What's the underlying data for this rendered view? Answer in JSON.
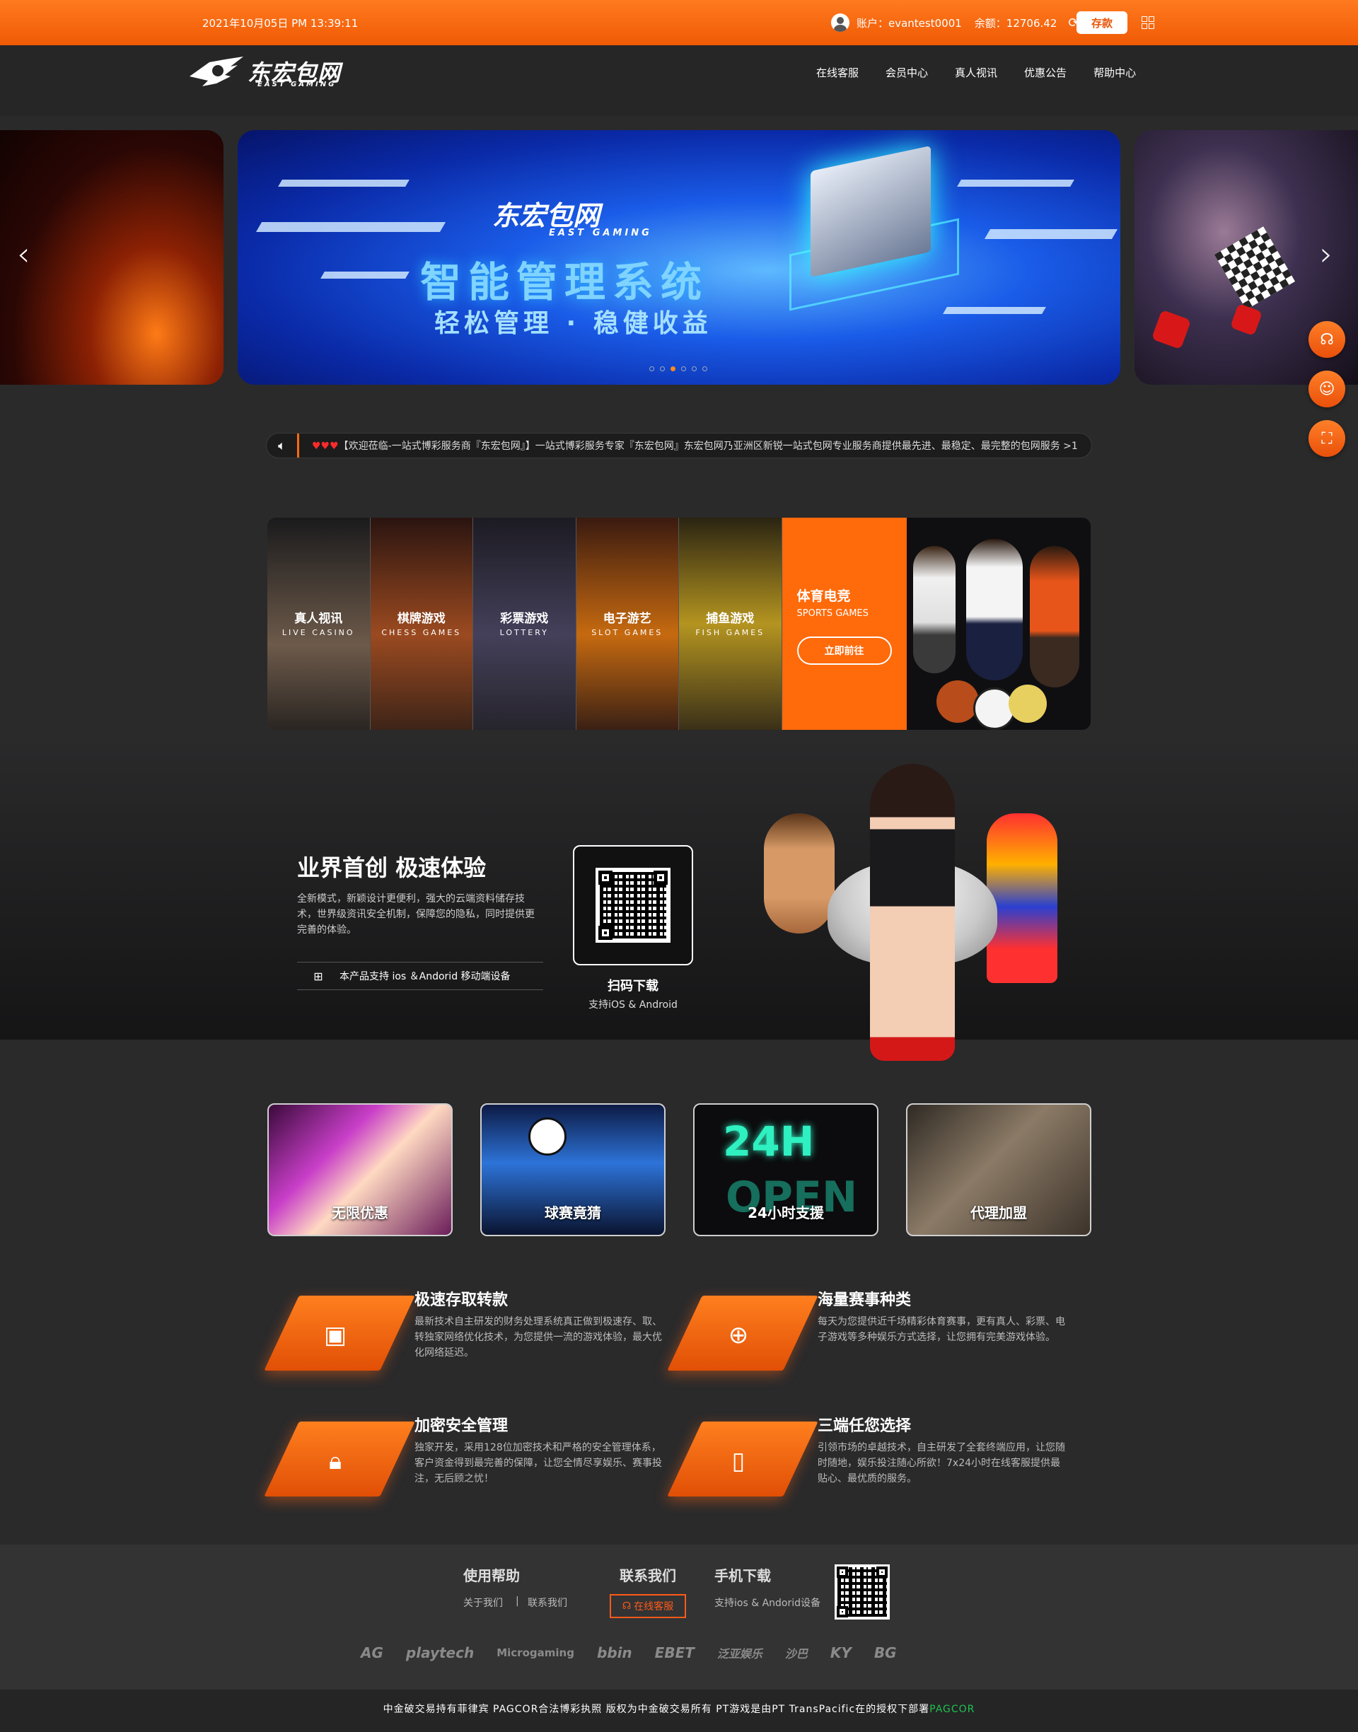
{
  "topbar": {
    "datetime": "2021年10月05日 PM 13:39:11",
    "account_label": "账户：evantest0001",
    "balance_label": "余额：12706.42",
    "deposit_label": "存款",
    "refresh_icon": "refresh-icon",
    "grid_icon": "grid-icon"
  },
  "header": {
    "logo_text": "东宏包网",
    "logo_sub": "EAST GAMING",
    "nav": [
      "在线客服",
      "会员中心",
      "真人视讯",
      "优惠公告",
      "帮助中心"
    ]
  },
  "banner": {
    "logo_text": "东宏包网",
    "logo_sub": "EAST GAMING",
    "title": "智能管理系统",
    "subtitle": "轻松管理 · 稳健收益",
    "slides": 6,
    "active_slide": 3
  },
  "marquee": {
    "hearts": "♥♥♥",
    "text": "【欢迎莅临-一站式博彩服务商『东宏包网』】一站式博彩服务专家『东宏包网』东宏包网乃亚洲区新锐一站式包网专业服务商提供最先进、最稳定、最完整的包网服务 >1"
  },
  "games": [
    {
      "title": "真人视讯",
      "en": "LIVE CASINO"
    },
    {
      "title": "棋牌游戏",
      "en": "CHESS GAMES"
    },
    {
      "title": "彩票游戏",
      "en": "LOTTERY"
    },
    {
      "title": "电子游艺",
      "en": "SLOT GAMES"
    },
    {
      "title": "捕鱼游戏",
      "en": "FISH GAMES"
    }
  ],
  "sports": {
    "title": "体育电竞",
    "en": "SPORTS GAMES",
    "button": "立即前往"
  },
  "app": {
    "heading": "业界首创 极速体验",
    "desc": "全新模式，新颖设计更便利，强大的云端资料储存技术，世界级资讯安全机制，保障您的隐私，同时提供更完善的体验。",
    "os_icons": "android-apple-icon",
    "support": "本产品支持 ios ＆Andorid 移动端设备",
    "scan_title": "扫码下载",
    "scan_sub": "支持iOS & Android"
  },
  "features": [
    "无限优惠",
    "球赛竟猜",
    "24小时支援",
    "代理加盟"
  ],
  "neon": {
    "top": "24H",
    "bottom": "OPEN"
  },
  "items": [
    {
      "title": "极速存取转款",
      "desc": "最新技术自主研发的财务处理系统真正做到极速存、取、转独家网络优化技术，为您提供一流的游戏体验，最大优化网络延迟。",
      "icon": "wallet-icon"
    },
    {
      "title": "海量赛事种类",
      "desc": "每天为您提供近千场精彩体育赛事，更有真人、彩票、电子游戏等多种娱乐方式选择，让您拥有完美游戏体验。",
      "icon": "basketball-icon"
    },
    {
      "title": "加密安全管理",
      "desc": "独家开发，采用128位加密技术和严格的安全管理体系，客户资金得到最完善的保障，让您全情尽享娱乐、赛事投注，无后顾之忧！",
      "icon": "lock-icon"
    },
    {
      "title": "三端任您选择",
      "desc": "引领市场的卓越技术，自主研发了全套终端应用，让您随时随地，娱乐投注随心所欲！7x24小时在线客服提供最贴心、最优质的服务。",
      "icon": "phone-icon"
    }
  ],
  "footer": {
    "help_title": "使用帮助",
    "about": "关于我们",
    "sep": "|",
    "contact_link": "联系我们",
    "contact_title": "联系我们",
    "cs_button": "在线客服",
    "download_title": "手机下载",
    "download_sub": "支持ios & Andorid设备",
    "partners": [
      "AG",
      "playtech",
      "Microgaming",
      "bbin",
      "EBET",
      "泛亚娱乐",
      "沙巴",
      "KY",
      "BG"
    ],
    "copyright": "中金破交易持有菲律宾 PAGCOR合法博彩执照 版权为中金破交易所有 PT游戏是由PT TransPacific在的授权下部署",
    "pagcor": "PAGCOR"
  },
  "colors": {
    "accent": "#ff6a0b",
    "background": "#2a2a2b",
    "footer": "#333334"
  }
}
